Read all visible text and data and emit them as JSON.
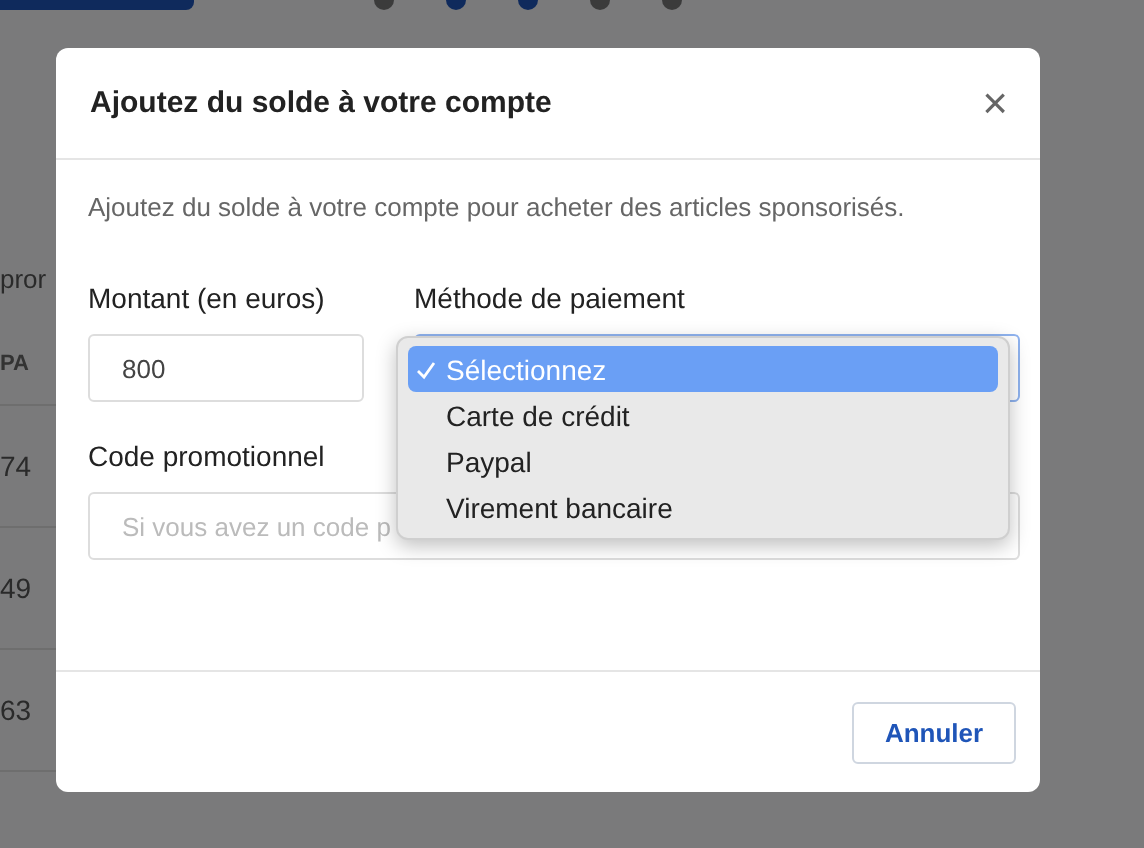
{
  "background": {
    "fragments": [
      "pror",
      "PA"
    ],
    "rows": [
      "74",
      "49",
      "63"
    ]
  },
  "dialog": {
    "title": "Ajoutez du solde à votre compte",
    "close": "×",
    "description": "Ajoutez du solde à votre compte pour acheter des articles sponsorisés.",
    "amount": {
      "label": "Montant (en euros)",
      "value": "800"
    },
    "payment": {
      "label": "Méthode de paiement",
      "expanded": true,
      "options": [
        {
          "label": "Sélectionnez",
          "selected": true
        },
        {
          "label": "Carte de crédit",
          "selected": false
        },
        {
          "label": "Paypal",
          "selected": false
        },
        {
          "label": "Virement bancaire",
          "selected": false
        }
      ]
    },
    "promo": {
      "label": "Code promotionnel",
      "placeholder": "Si vous avez un code p"
    },
    "buttons": [
      "Annuler"
    ]
  }
}
